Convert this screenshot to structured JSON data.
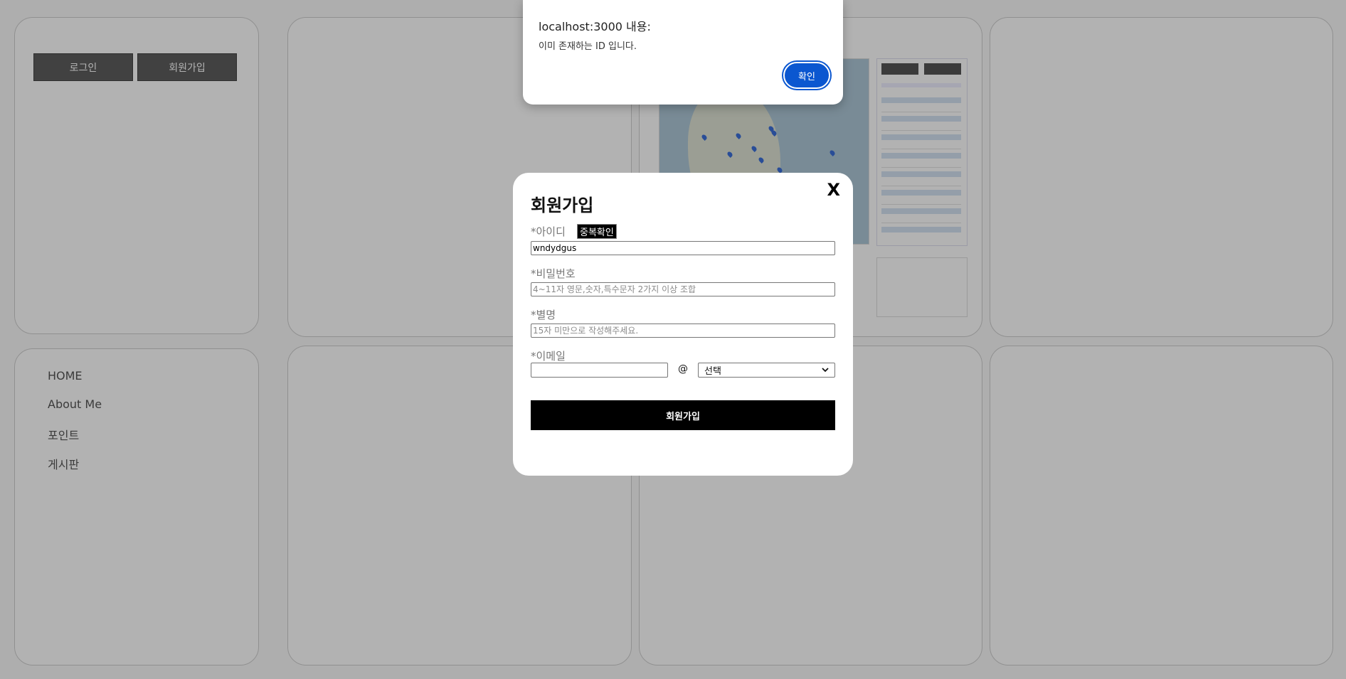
{
  "sidebar": {
    "auth_buttons": {
      "login": "로그인",
      "signup": "회원가입"
    },
    "nav": [
      "HOME",
      "About Me",
      "포인트",
      "게시판"
    ]
  },
  "signup_modal": {
    "title": "회원가입",
    "close_label": "X",
    "id_label": "*아이디",
    "dup_check_button": "중복확인",
    "id_value": "wndydgus",
    "password_label": "*비밀번호",
    "password_placeholder": "4~11자 영문,숫자,특수문자 2가지 이상 조합",
    "nickname_label": "*별명",
    "nickname_placeholder": "15자 미만으로 작성해주세요.",
    "email_label": "*이메일",
    "email_at": "@",
    "email_domain_selected": "선택",
    "submit_button": "회원가입"
  },
  "alert": {
    "title": "localhost:3000 내용:",
    "message": "이미 존재하는 ID 입니다.",
    "ok_button": "확인"
  },
  "colors": {
    "overlay": "rgba(0,0,0,0.30)",
    "alert_ok": "#0b57d0",
    "auth_button": "#5e5e5e",
    "submit_button": "#000000"
  }
}
